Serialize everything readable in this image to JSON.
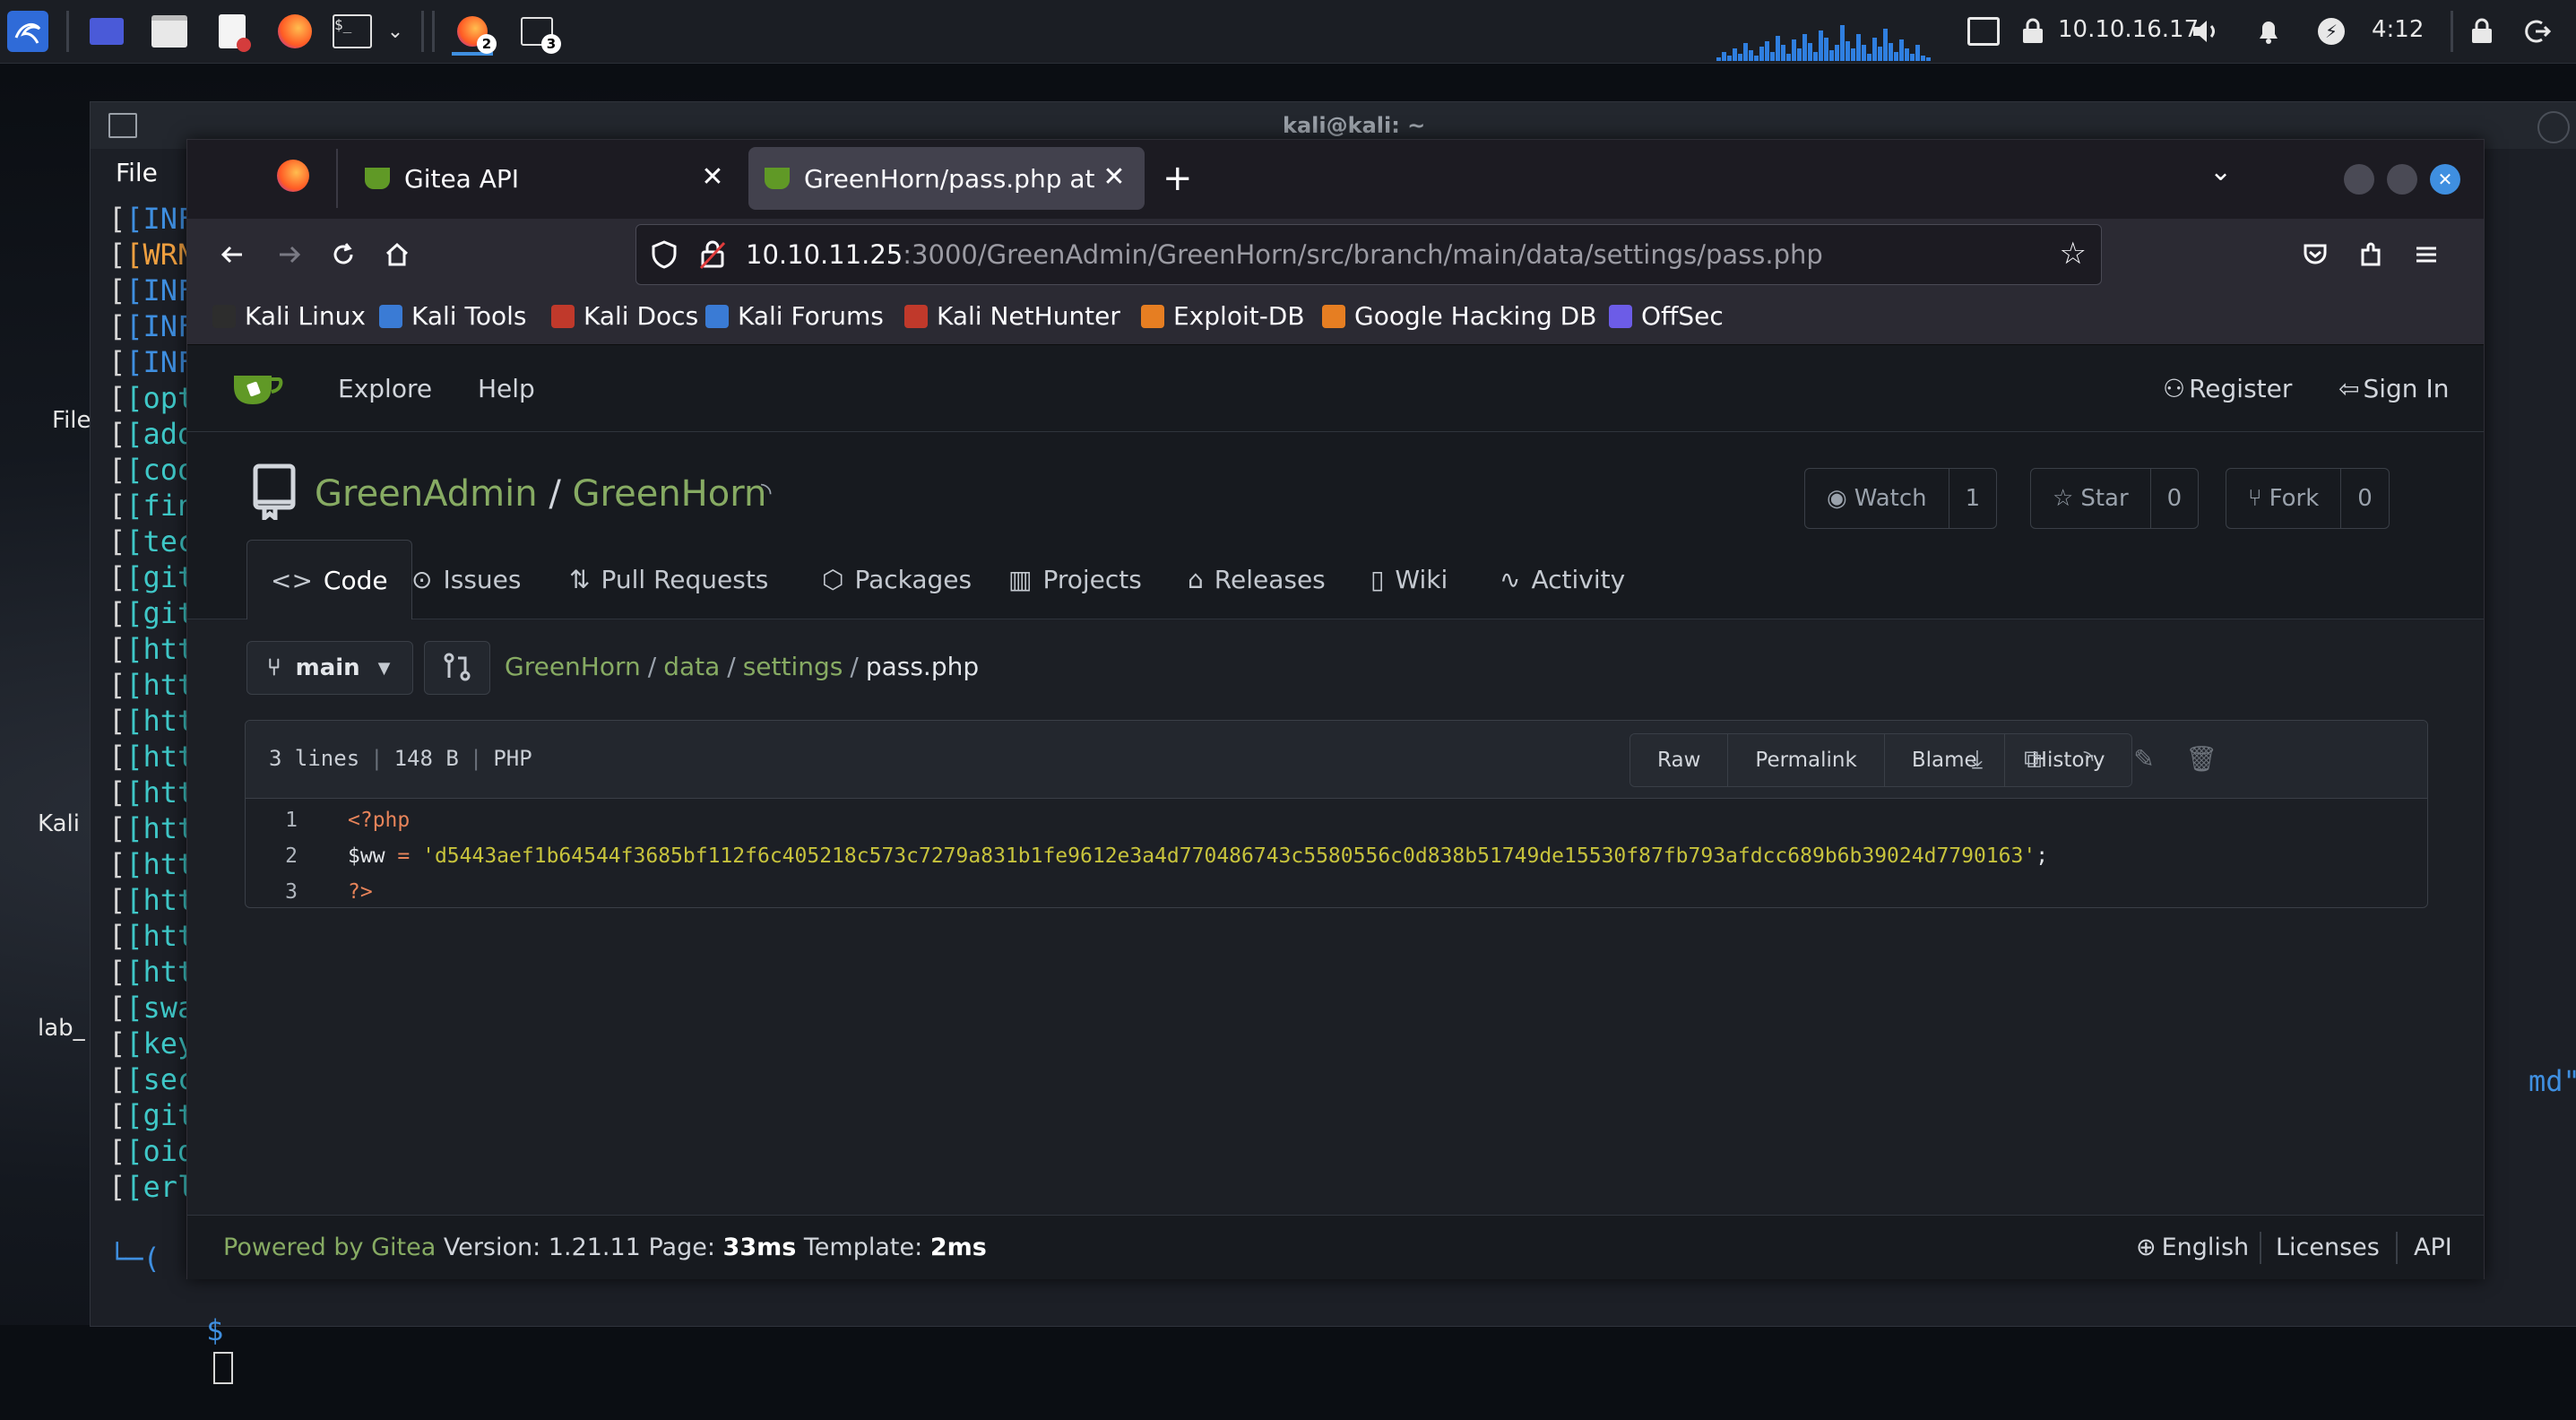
{
  "colors": {
    "accent_green": "#87ab63",
    "firefox_bg": "#1c1b22",
    "gitea_bg": "#1c1f25",
    "kali_blue": "#3f8fe0"
  },
  "panel": {
    "ip": "10.10.16.17",
    "clock": "4:12",
    "badge_firefox": "2",
    "badge_terminal": "3"
  },
  "desktop": {
    "icon_labels": [
      "File",
      "Kali",
      "lab_"
    ]
  },
  "terminal": {
    "title": "kali@kali: ~",
    "menu_file": "File",
    "lines": [
      {
        "text": "[INF",
        "cls": "blue"
      },
      {
        "text": "[WRN",
        "cls": "orange"
      },
      {
        "text": "[INF",
        "cls": "blue"
      },
      {
        "text": "[INF",
        "cls": "blue"
      },
      {
        "text": "[INF",
        "cls": "blue"
      },
      {
        "text": "[opti",
        "cls": "teal"
      },
      {
        "text": "[adde",
        "cls": "teal"
      },
      {
        "text": "[cool",
        "cls": "teal"
      },
      {
        "text": "[fing",
        "cls": "teal"
      },
      {
        "text": "[tech",
        "cls": "teal"
      },
      {
        "text": "[gite",
        "cls": "teal"
      },
      {
        "text": "[gite",
        "cls": "teal"
      },
      {
        "text": "[http",
        "cls": "teal"
      },
      {
        "text": "[http",
        "cls": "teal"
      },
      {
        "text": "[http",
        "cls": "teal"
      },
      {
        "text": "[http",
        "cls": "teal"
      },
      {
        "text": "[http",
        "cls": "teal"
      },
      {
        "text": "[http",
        "cls": "teal"
      },
      {
        "text": "[http",
        "cls": "teal"
      },
      {
        "text": "[http",
        "cls": "teal"
      },
      {
        "text": "[http",
        "cls": "teal"
      },
      {
        "text": "[http",
        "cls": "teal"
      },
      {
        "text": "[swag",
        "cls": "teal"
      },
      {
        "text": "[keyc",
        "cls": "teal"
      },
      {
        "text": "[secu",
        "cls": "teal"
      },
      {
        "text": "[gite",
        "cls": "teal"
      },
      {
        "text": "[oidc",
        "cls": "teal"
      },
      {
        "text": "[erla",
        "cls": "teal"
      }
    ],
    "right_fragment": "md\"]",
    "prompt_top": "└─(",
    "prompt": "$"
  },
  "browser": {
    "tabs": [
      {
        "label": "Gitea API"
      },
      {
        "label": "GreenHorn/pass.php at m"
      }
    ],
    "new_tab": "+",
    "url_host": "10.10.11.25",
    "url_rest": ":3000/GreenAdmin/GreenHorn/src/branch/main/data/settings/pass.php",
    "bookmarks": [
      {
        "label": "Kali Linux",
        "color": "#2d2d2d"
      },
      {
        "label": "Kali Tools",
        "color": "#3a7bd5"
      },
      {
        "label": "Kali Docs",
        "color": "#c0392b"
      },
      {
        "label": "Kali Forums",
        "color": "#3a7bd5"
      },
      {
        "label": "Kali NetHunter",
        "color": "#c0392b"
      },
      {
        "label": "Exploit-DB",
        "color": "#e67e22"
      },
      {
        "label": "Google Hacking DB",
        "color": "#e67e22"
      },
      {
        "label": "OffSec",
        "color": "#6c5ce7"
      }
    ]
  },
  "gitea": {
    "nav": {
      "explore": "Explore",
      "help": "Help",
      "register": "Register",
      "signin": "Sign In"
    },
    "repo": {
      "owner": "GreenAdmin",
      "slash": "/",
      "name": "GreenHorn"
    },
    "actions": {
      "watch": "Watch",
      "watch_count": "1",
      "star": "Star",
      "star_count": "0",
      "fork": "Fork",
      "fork_count": "0"
    },
    "tabs": [
      "Code",
      "Issues",
      "Pull Requests",
      "Packages",
      "Projects",
      "Releases",
      "Wiki",
      "Activity"
    ],
    "branch": "main",
    "breadcrumb": {
      "root": "GreenHorn",
      "d1": "data",
      "d2": "settings",
      "file": "pass.php",
      "sep": "/"
    },
    "file": {
      "lines_count": "3 lines",
      "size": "148 B",
      "lang": "PHP",
      "buttons": [
        "Raw",
        "Permalink",
        "Blame",
        "History"
      ]
    },
    "code": [
      {
        "n": "1",
        "open": "<?php"
      },
      {
        "n": "2",
        "var": "$ww",
        "op": " = ",
        "str": "'d5443aef1b64544f3685bf112f6c405218c573c7279a831b1fe9612e3a4d770486743c5580556c0d838b51749de15530f87fb793afdcc689b6b39024d7790163'",
        "end": ";"
      },
      {
        "n": "3",
        "close": "?>"
      }
    ],
    "footer": {
      "powered": "Powered by Gitea",
      "version": "Version: 1.21.11",
      "page_label": "Page:",
      "page_time": "33ms",
      "template_label": "Template:",
      "template_time": "2ms",
      "language": "English",
      "licenses": "Licenses",
      "api": "API"
    }
  }
}
